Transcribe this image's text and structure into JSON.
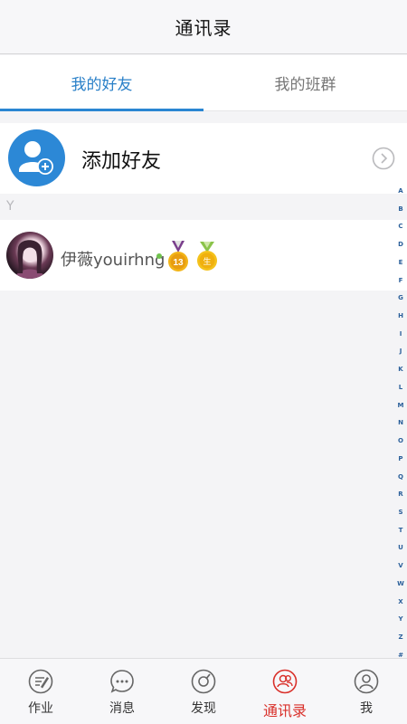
{
  "header": {
    "title": "通讯录"
  },
  "tabs": [
    {
      "label": "我的好友",
      "active": true
    },
    {
      "label": "我的班群",
      "active": false
    }
  ],
  "add_friend": {
    "label": "添加好友",
    "icon": "add-user-icon"
  },
  "section": {
    "letter": "Y"
  },
  "friend": {
    "name": "伊薇youirhng",
    "badge_level": "13",
    "badge2_text": "生"
  },
  "index_letters": [
    "A",
    "B",
    "C",
    "D",
    "E",
    "F",
    "G",
    "H",
    "I",
    "J",
    "K",
    "L",
    "M",
    "N",
    "O",
    "P",
    "Q",
    "R",
    "S",
    "T",
    "U",
    "V",
    "W",
    "X",
    "Y",
    "Z",
    "#"
  ],
  "bottom_tabs": [
    {
      "label": "作业",
      "icon": "homework-icon"
    },
    {
      "label": "消息",
      "icon": "message-icon"
    },
    {
      "label": "发现",
      "icon": "discover-icon"
    },
    {
      "label": "通讯录",
      "icon": "contacts-icon",
      "active": true
    },
    {
      "label": "我",
      "icon": "profile-icon"
    }
  ],
  "colors": {
    "accent_blue": "#2a86d2",
    "active_red": "#d9302a",
    "online_green": "#6fc24c"
  }
}
